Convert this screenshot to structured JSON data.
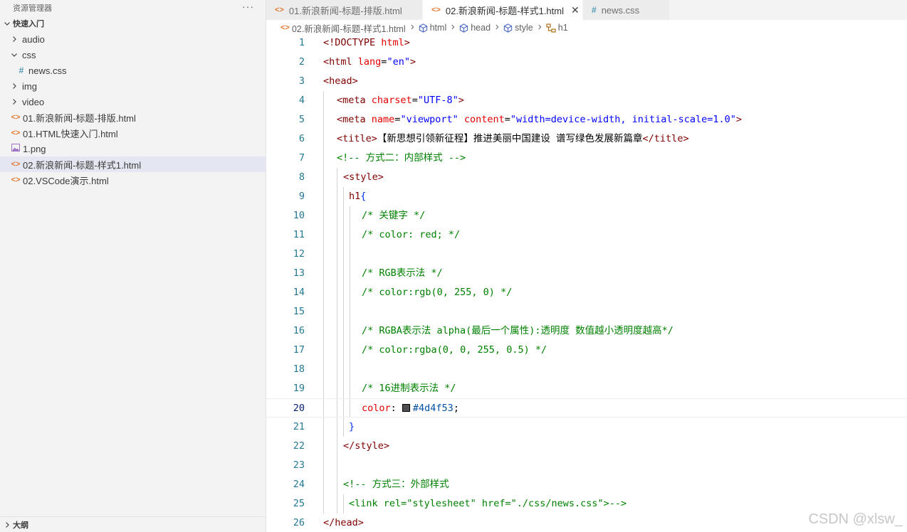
{
  "sidebar": {
    "title": "资源管理器",
    "more": "···",
    "section": "快速入门",
    "items": [
      {
        "label": "audio",
        "type": "folder",
        "expanded": false,
        "depth": 1
      },
      {
        "label": "css",
        "type": "folder",
        "expanded": true,
        "depth": 1
      },
      {
        "label": "news.css",
        "type": "css",
        "depth": 2
      },
      {
        "label": "img",
        "type": "folder",
        "expanded": false,
        "depth": 1
      },
      {
        "label": "video",
        "type": "folder",
        "expanded": false,
        "depth": 1
      },
      {
        "label": "01.新浪新闻-标题-排版.html",
        "type": "html",
        "depth": 1
      },
      {
        "label": "01.HTML快速入门.html",
        "type": "html",
        "depth": 1
      },
      {
        "label": "1.png",
        "type": "png",
        "depth": 1
      },
      {
        "label": "02.新浪新闻-标题-样式1.html",
        "type": "html",
        "depth": 1,
        "selected": true
      },
      {
        "label": "02.VSCode演示.html",
        "type": "html",
        "depth": 1
      }
    ],
    "outline": "大纲"
  },
  "tabs": [
    {
      "label": "01.新浪新闻-标题-排版.html",
      "icon": "html",
      "active": false
    },
    {
      "label": "02.新浪新闻-标题-样式1.html",
      "icon": "html",
      "active": true
    },
    {
      "label": "news.css",
      "icon": "css",
      "active": false
    }
  ],
  "breadcrumb": {
    "file": "02.新浪新闻-标题-样式1.html",
    "parts": [
      "html",
      "head",
      "style",
      "h1"
    ]
  },
  "editor": {
    "current_line": 20,
    "lines": [
      {
        "n": "1",
        "guides": 0,
        "tokens": [
          [
            "t-tag",
            "<!DOCTYPE "
          ],
          [
            "t-attr",
            "html"
          ],
          [
            "t-tag",
            ">"
          ]
        ]
      },
      {
        "n": "2",
        "guides": 0,
        "tokens": [
          [
            "t-tag",
            "<html "
          ],
          [
            "t-attr",
            "lang"
          ],
          [
            "t-txt",
            "="
          ],
          [
            "t-str",
            "\"en\""
          ],
          [
            "t-tag",
            ">"
          ]
        ]
      },
      {
        "n": "3",
        "guides": 0,
        "tokens": [
          [
            "t-tag",
            "<head>"
          ]
        ]
      },
      {
        "n": "4",
        "guides": 1,
        "tokens": [
          [
            "t-tag",
            "<meta "
          ],
          [
            "t-attr",
            "charset"
          ],
          [
            "t-txt",
            "="
          ],
          [
            "t-str",
            "\"UTF-8\""
          ],
          [
            "t-tag",
            ">"
          ]
        ]
      },
      {
        "n": "5",
        "guides": 1,
        "tokens": [
          [
            "t-tag",
            "<meta "
          ],
          [
            "t-attr",
            "name"
          ],
          [
            "t-txt",
            "="
          ],
          [
            "t-str",
            "\"viewport\""
          ],
          [
            "t-txt",
            " "
          ],
          [
            "t-attr",
            "content"
          ],
          [
            "t-txt",
            "="
          ],
          [
            "t-str",
            "\"width=device-width, initial-scale=1.0\""
          ],
          [
            "t-tag",
            ">"
          ]
        ]
      },
      {
        "n": "6",
        "guides": 1,
        "tokens": [
          [
            "t-tag",
            "<title>"
          ],
          [
            "t-txt",
            "【新思想引领新征程】推进美丽中国建设 谱写绿色发展新篇章"
          ],
          [
            "t-tag",
            "</title>"
          ]
        ]
      },
      {
        "n": "7",
        "guides": 1,
        "tokens": [
          [
            "t-com",
            "<!-- 方式二：内部样式 -->"
          ]
        ]
      },
      {
        "n": "8",
        "guides": 2,
        "tokens": [
          [
            "t-tag",
            "<style>"
          ]
        ]
      },
      {
        "n": "9",
        "guides": 3,
        "tokens": [
          [
            "t-sel",
            "h1"
          ],
          [
            "t-br",
            "{"
          ]
        ]
      },
      {
        "n": "10",
        "guides": 4,
        "tokens": [
          [
            "t-com",
            "/* 关键字 */"
          ]
        ]
      },
      {
        "n": "11",
        "guides": 4,
        "tokens": [
          [
            "t-com",
            "/* color: red; */"
          ]
        ]
      },
      {
        "n": "12",
        "guides": 4,
        "tokens": []
      },
      {
        "n": "13",
        "guides": 4,
        "tokens": [
          [
            "t-com",
            "/* RGB表示法 */"
          ]
        ]
      },
      {
        "n": "14",
        "guides": 4,
        "tokens": [
          [
            "t-com",
            "/* color:rgb(0, 255, 0) */"
          ]
        ]
      },
      {
        "n": "15",
        "guides": 4,
        "tokens": []
      },
      {
        "n": "16",
        "guides": 4,
        "tokens": [
          [
            "t-com",
            "/* RGBA表示法 alpha(最后一个属性):透明度 数值越小透明度越高*/"
          ]
        ]
      },
      {
        "n": "17",
        "guides": 4,
        "tokens": [
          [
            "t-com",
            "/* color:rgba(0, 0, 255, 0.5) */"
          ]
        ]
      },
      {
        "n": "18",
        "guides": 4,
        "tokens": []
      },
      {
        "n": "19",
        "guides": 4,
        "tokens": [
          [
            "t-com",
            "/* 16进制表示法 */"
          ]
        ]
      },
      {
        "n": "20",
        "guides": 4,
        "tokens": [
          [
            "t-prop",
            "color"
          ],
          [
            "t-txt",
            ": "
          ],
          [
            "swatch",
            "#4d4f53"
          ],
          [
            "t-val",
            "#4d4f53"
          ],
          [
            "t-txt",
            ";"
          ]
        ]
      },
      {
        "n": "21",
        "guides": 3,
        "tokens": [
          [
            "t-br",
            "}"
          ]
        ]
      },
      {
        "n": "22",
        "guides": 2,
        "tokens": [
          [
            "t-tag",
            "</style>"
          ]
        ]
      },
      {
        "n": "23",
        "guides": 2,
        "tokens": []
      },
      {
        "n": "24",
        "guides": 2,
        "tokens": [
          [
            "t-com",
            "<!-- 方式三：外部样式"
          ]
        ]
      },
      {
        "n": "25",
        "guides": 3,
        "tokens": [
          [
            "t-com",
            "<link rel=\"stylesheet\" href=\"./css/news.css\">-->"
          ]
        ]
      },
      {
        "n": "26",
        "guides": 0,
        "tokens": [
          [
            "t-tag",
            "</head>"
          ]
        ]
      }
    ]
  },
  "watermark": "CSDN @xlsw_",
  "colors": {
    "swatch": "#4d4f53",
    "selection": "#e4e6f1",
    "html_icon": "#e37933",
    "css_icon": "#519aba"
  }
}
